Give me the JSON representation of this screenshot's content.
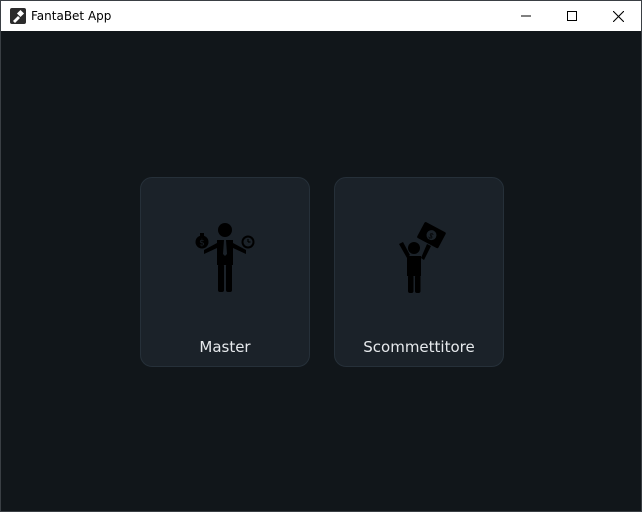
{
  "window": {
    "title": "FantaBet App"
  },
  "cards": [
    {
      "label": "Master",
      "icon": "manager-balancing-icon"
    },
    {
      "label": "Scommettitore",
      "icon": "person-holding-ticket-icon"
    }
  ],
  "colors": {
    "background": "#11161a",
    "card": "#1b2229",
    "card_border": "#263039",
    "label": "#e6e9ec"
  }
}
